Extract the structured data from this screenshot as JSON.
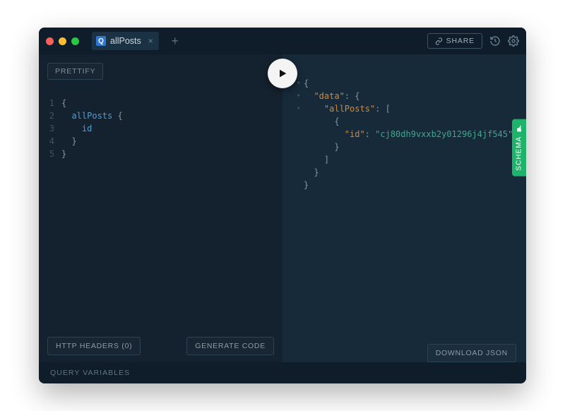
{
  "titlebar": {
    "tab_badge": "Q",
    "tab_label": "allPosts",
    "share_label": "SHARE"
  },
  "toolbar": {
    "prettify_label": "PRETTIFY"
  },
  "editor": {
    "lines": [
      {
        "n": "1",
        "text": "{"
      },
      {
        "n": "2",
        "text": "  allPosts {"
      },
      {
        "n": "3",
        "text": "    id"
      },
      {
        "n": "4",
        "text": "  }"
      },
      {
        "n": "5",
        "text": "}"
      }
    ]
  },
  "response": {
    "data_key": "\"data\"",
    "allposts_key": "\"allPosts\"",
    "id_key": "\"id\"",
    "id_value": "\"cj80dh9vxxb2y01296j4jf545\""
  },
  "buttons": {
    "http_headers": "HTTP HEADERS (0)",
    "generate_code": "GENERATE CODE",
    "download_json": "DOWNLOAD JSON"
  },
  "footer": {
    "query_variables": "QUERY VARIABLES"
  },
  "side": {
    "schema": "SCHEMA"
  }
}
